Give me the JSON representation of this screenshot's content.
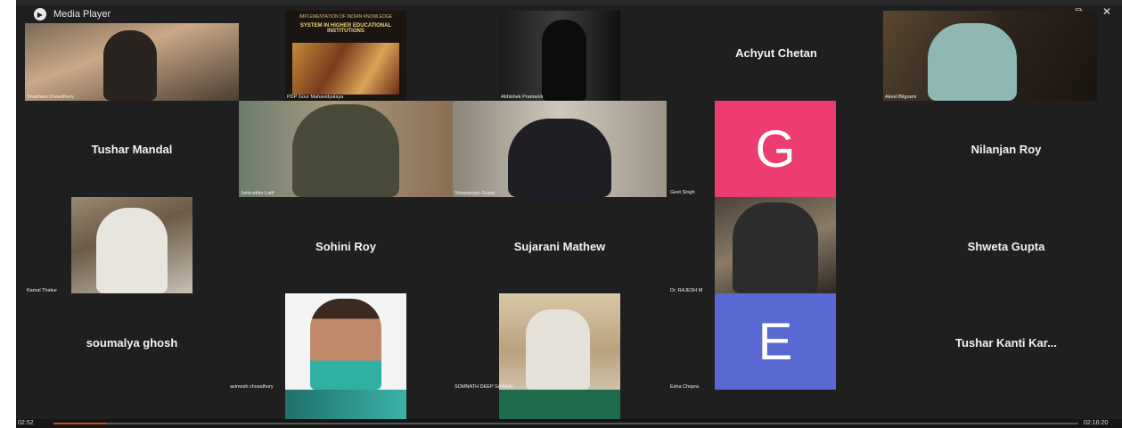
{
  "window": {
    "title": "Media Player",
    "controls": [
      "–",
      "⧉",
      "✕"
    ]
  },
  "participants_video": [
    {
      "caption": "Shubham Chowdhury"
    },
    {
      "caption": "PDP Gour Mahavidyalaya"
    },
    {
      "caption": "Abhishek Pramanik"
    },
    {
      "caption": "Akeel Bilgrami"
    },
    {
      "caption": "Jahiruddin Latif"
    },
    {
      "caption": "Shwetanjan Gupta"
    },
    {
      "caption": "Kamal Thakur"
    },
    {
      "caption": "Dr. RAJESH M"
    },
    {
      "caption": "avimesh chowdhury"
    },
    {
      "caption": "SOMNATH DEEP SANKAL"
    }
  ],
  "slide": {
    "line1": "IMPLEMENTATION OF INDIAN KNOWLEDGE",
    "line2": "SYSTEM IN HIGHER EDUCATIONAL INSTITUTIONS"
  },
  "name_tiles": [
    "Achyut Chetan",
    "Tushar Mandal",
    "Nilanjan Roy",
    "Sohini Roy",
    "Sujarani Mathew",
    "Shweta Gupta",
    "soumalya ghosh",
    "Tushar Kanti Kar..."
  ],
  "avatar_tiles": [
    {
      "letter": "G",
      "color": "#ec3c70",
      "caption": "Geet Singh"
    },
    {
      "letter": "E",
      "color": "#5a68d3",
      "caption": "Esha Chopra"
    }
  ],
  "player": {
    "elapsed": "02:52",
    "total": "02:16:20"
  }
}
